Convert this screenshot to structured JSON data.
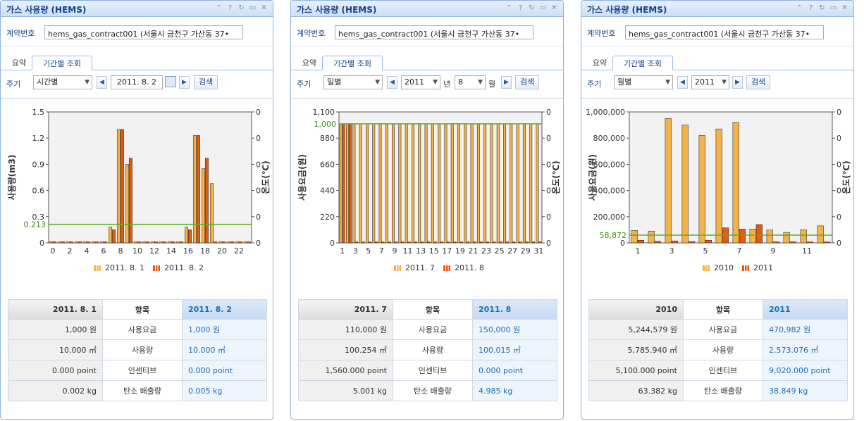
{
  "panels": [
    {
      "title": "가스 사용량 (HEMS)",
      "contract_label": "계약번호",
      "contract_value": "hems_gas_contract001 (서울시 금천구 가산동 37•",
      "tabs": [
        "요약",
        "기간별 조회"
      ],
      "period_label": "주기",
      "period_select": "시간별",
      "date_value": "2011. 8. 2",
      "search_label": "검색",
      "chart_data": {
        "type": "bar",
        "ylabel": "사용량(m3)",
        "y2label": "온도(℃)",
        "ylim": [
          0,
          1.5
        ],
        "yticks": [
          "0",
          "0.3",
          "0.6",
          "0.9",
          "1.2",
          "1.5"
        ],
        "y2ticks": [
          "0",
          "0",
          "0",
          "0",
          "0",
          "0"
        ],
        "x": [
          0,
          1,
          2,
          3,
          4,
          5,
          6,
          7,
          8,
          9,
          10,
          11,
          12,
          13,
          14,
          15,
          16,
          17,
          18,
          19,
          20,
          21,
          22,
          23
        ],
        "xticks": [
          "0",
          "2",
          "4",
          "6",
          "8",
          "10",
          "12",
          "14",
          "16",
          "18",
          "20",
          "22"
        ],
        "series": [
          {
            "name": "2011. 8. 1",
            "color": "#f6b24a",
            "values": [
              0,
              0,
              0,
              0,
              0,
              0,
              0,
              0.18,
              1.3,
              0.9,
              0,
              0,
              0,
              0,
              0,
              0,
              0.18,
              1.23,
              0.85,
              0.68,
              0,
              0,
              0,
              0
            ]
          },
          {
            "name": "2011. 8. 2",
            "color": "#e8590f",
            "values": [
              0,
              0,
              0,
              0,
              0,
              0,
              0,
              0.15,
              1.3,
              0.97,
              0,
              0,
              0,
              0,
              0,
              0,
              0.15,
              1.23,
              0.97,
              0,
              0,
              0,
              0,
              0
            ]
          }
        ],
        "avg_line": 0.213,
        "avg_label": "0.213"
      },
      "table": {
        "headers": [
          "2011. 8. 1",
          "항목",
          "2011. 8. 2"
        ],
        "rows": [
          [
            "1,000 원",
            "사용요금",
            "1,000 원"
          ],
          [
            "10.000 ㎥",
            "사용량",
            "10.000 ㎥"
          ],
          [
            "0.000 point",
            "인센티브",
            "0.000 point"
          ],
          [
            "0.002 kg",
            "탄소 배출량",
            "0.005 kg"
          ]
        ]
      }
    },
    {
      "title": "가스 사용량 (HEMS)",
      "contract_label": "계약번호",
      "contract_value": "hems_gas_contract001 (서울시 금천구 가산동 37•",
      "tabs": [
        "요약",
        "기간별 조회"
      ],
      "period_label": "주기",
      "period_select": "일별",
      "year_value": "2011",
      "year_unit": "년",
      "month_value": "8",
      "month_unit": "월",
      "search_label": "검색",
      "chart_data": {
        "type": "bar",
        "ylabel": "사용요금(원)",
        "y2label": "온도(℃)",
        "ylim": [
          0,
          1100
        ],
        "yticks": [
          "0",
          "220",
          "440",
          "660",
          "880",
          "1,100"
        ],
        "y2ticks": [
          "0",
          "0",
          "0",
          "0",
          "0",
          "0"
        ],
        "x": [
          1,
          2,
          3,
          4,
          5,
          6,
          7,
          8,
          9,
          10,
          11,
          12,
          13,
          14,
          15,
          16,
          17,
          18,
          19,
          20,
          21,
          22,
          23,
          24,
          25,
          26,
          27,
          28,
          29,
          30,
          31
        ],
        "xticks": [
          "1",
          "3",
          "5",
          "7",
          "9",
          "11",
          "13",
          "15",
          "17",
          "19",
          "21",
          "23",
          "25",
          "27",
          "29",
          "31"
        ],
        "series": [
          {
            "name": "2011. 7",
            "color": "#f6b24a",
            "values": [
              1000,
              1000,
              1000,
              1000,
              1000,
              1000,
              1000,
              1000,
              1000,
              1000,
              1000,
              1000,
              1000,
              1000,
              1000,
              1000,
              1000,
              1000,
              1000,
              1000,
              1000,
              1000,
              1000,
              1000,
              1000,
              1000,
              1000,
              1000,
              1000,
              1000,
              1000
            ]
          },
          {
            "name": "2011. 8",
            "color": "#e8590f",
            "values": [
              1000,
              1000,
              0,
              0,
              0,
              0,
              0,
              0,
              0,
              0,
              0,
              0,
              0,
              0,
              0,
              0,
              0,
              0,
              0,
              0,
              0,
              0,
              0,
              0,
              0,
              0,
              0,
              0,
              0,
              0,
              0
            ]
          }
        ],
        "avg_line": 1000,
        "avg_label": "1,000"
      },
      "table": {
        "headers": [
          "2011. 7",
          "항목",
          "2011. 8"
        ],
        "rows": [
          [
            "110,000 원",
            "사용요금",
            "150,000 원"
          ],
          [
            "100.254 ㎥",
            "사용량",
            "100.015 ㎥"
          ],
          [
            "1,560.000 point",
            "인센티브",
            "0.000 point"
          ],
          [
            "5.001 kg",
            "탄소 배출량",
            "4.985 kg"
          ]
        ]
      }
    },
    {
      "title": "가스 사용량 (HEMS)",
      "contract_label": "계약번호",
      "contract_value": "hems_gas_contract001 (서울시 금천구 가산동 37•",
      "tabs": [
        "요약",
        "기간별 조회"
      ],
      "period_label": "주기",
      "period_select": "월별",
      "year_value": "2011",
      "search_label": "검색",
      "chart_data": {
        "type": "bar",
        "ylabel": "사용요금(원)",
        "y2label": "온도(℃)",
        "ylim": [
          0,
          1000000
        ],
        "yticks": [
          "0",
          "200,000",
          "400,000",
          "600,000",
          "800,000",
          "1,000,000"
        ],
        "y2ticks": [
          "0",
          "0",
          "0",
          "0",
          "0",
          "0"
        ],
        "x": [
          1,
          2,
          3,
          4,
          5,
          6,
          7,
          8,
          9,
          10,
          11,
          12
        ],
        "xticks": [
          "1",
          "3",
          "5",
          "7",
          "9",
          "11"
        ],
        "series": [
          {
            "name": "2010",
            "color": "#f6b24a",
            "values": [
              95000,
              90000,
              950000,
              900000,
              820000,
              870000,
              920000,
              105000,
              98000,
              80000,
              100000,
              130000
            ]
          },
          {
            "name": "2011",
            "color": "#e8590f",
            "values": [
              20000,
              12000,
              15000,
              10000,
              20000,
              115000,
              105000,
              140000,
              0,
              0,
              0,
              0
            ]
          }
        ],
        "avg_line": 58872,
        "avg_label": "58,872"
      },
      "table": {
        "headers": [
          "2010",
          "항목",
          "2011"
        ],
        "rows": [
          [
            "5,244,579 원",
            "사용요금",
            "470,982 원"
          ],
          [
            "5,785.940 ㎥",
            "사용량",
            "2,573.076 ㎥"
          ],
          [
            "5,100.000 point",
            "인센티브",
            "9,020.000 point"
          ],
          [
            "63.382 kg",
            "탄소 배출량",
            "38.849 kg"
          ]
        ]
      }
    }
  ]
}
